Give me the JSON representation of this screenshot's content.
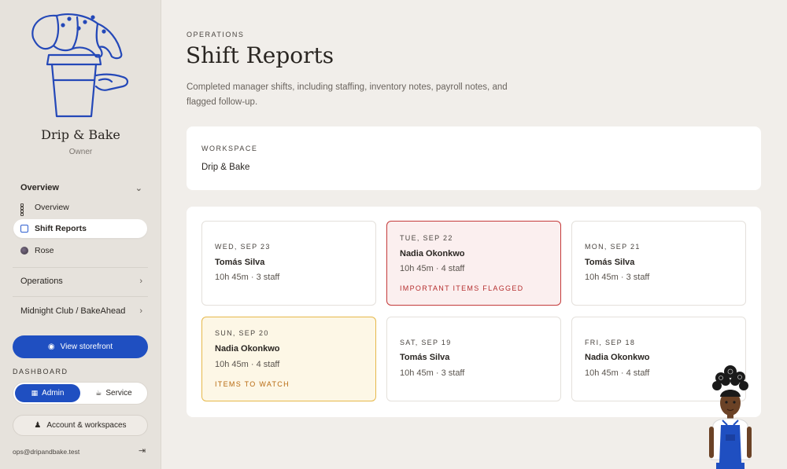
{
  "sidebar": {
    "brand_name": "Drip & Bake",
    "brand_role": "Owner",
    "overview_section": {
      "label": "Overview",
      "icon": "chevron-down-icon"
    },
    "items": [
      {
        "label": "Overview",
        "icon": "grid-icon"
      },
      {
        "label": "Shift Reports",
        "icon": "edit-icon",
        "active": true
      },
      {
        "label": "Rose",
        "icon": "avatar"
      }
    ],
    "operations_section": {
      "label": "Operations",
      "icon": "chevron-right-icon"
    },
    "club_section": {
      "label": "Midnight Club / BakeAhead",
      "icon": "chevron-right-icon"
    },
    "storefront_button": "View storefront",
    "dashboard_label": "DASHBOARD",
    "toggle": {
      "admin": "Admin",
      "service": "Service",
      "selected": "Admin"
    },
    "account_button": "Account & workspaces",
    "email": "ops@dripandbake.test"
  },
  "main": {
    "eyebrow": "OPERATIONS",
    "title": "Shift Reports",
    "description": "Completed manager shifts, including staffing, inventory notes, payroll notes, and flagged follow-up.",
    "workspace": {
      "label": "WORKSPACE",
      "value": "Drip & Bake"
    },
    "shifts": [
      {
        "date": "WED, SEP 23",
        "manager": "Tomás Silva",
        "meta": "10h 45m · 3 staff",
        "flag": ""
      },
      {
        "date": "TUE, SEP 22",
        "manager": "Nadia Okonkwo",
        "meta": "10h 45m · 4 staff",
        "flag": "IMPORTANT ITEMS FLAGGED"
      },
      {
        "date": "MON, SEP 21",
        "manager": "Tomás Silva",
        "meta": "10h 45m · 3 staff",
        "flag": ""
      },
      {
        "date": "SUN, SEP 20",
        "manager": "Nadia Okonkwo",
        "meta": "10h 45m · 4 staff",
        "flag": "ITEMS TO WATCH"
      },
      {
        "date": "SAT, SEP 19",
        "manager": "Tomás Silva",
        "meta": "10h 45m · 3 staff",
        "flag": ""
      },
      {
        "date": "FRI, SEP 18",
        "manager": "Nadia Okonkwo",
        "meta": "10h 45m · 4 staff",
        "flag": ""
      }
    ]
  },
  "colors": {
    "accent": "#1f4fc1",
    "flag_red": "#c43a3a",
    "flag_amber": "#e6b84a",
    "background": "#f1eeea"
  }
}
